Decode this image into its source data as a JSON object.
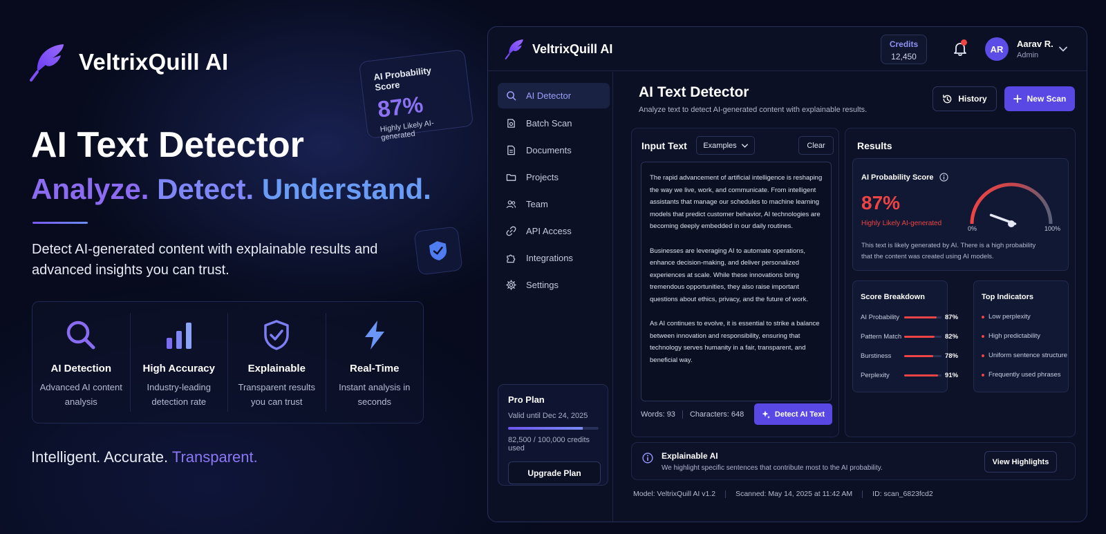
{
  "brand": {
    "name": "VeltrixQuill AI"
  },
  "hero": {
    "title": "AI Text Detector",
    "subtitle_parts": [
      "Analyze.",
      "Detect.",
      "Understand."
    ],
    "description": "Detect AI-generated content with explainable results and advanced insights you can trust.",
    "tagline_main": "Intelligent. Accurate.",
    "tagline_accent": "Transparent."
  },
  "features": [
    {
      "icon": "magnifier-icon",
      "title": "AI Detection",
      "desc": "Advanced AI content analysis"
    },
    {
      "icon": "bar-chart-icon",
      "title": "High Accuracy",
      "desc": "Industry-leading detection rate"
    },
    {
      "icon": "shield-check-icon",
      "title": "Explainable",
      "desc": "Transparent results you can trust"
    },
    {
      "icon": "lightning-icon",
      "title": "Real-Time",
      "desc": "Instant analysis in seconds"
    }
  ],
  "float_card": {
    "label": "AI Probability Score",
    "value": "87%",
    "verdict": "Highly Likely AI-generated"
  },
  "app": {
    "brand": "VeltrixQuill AI",
    "credits": {
      "label": "Credits",
      "value": "12,450"
    },
    "user": {
      "initials": "AR",
      "name": "Aarav R.",
      "role": "Admin"
    },
    "nav": [
      {
        "label": "AI Detector",
        "icon": "search-icon",
        "active": true
      },
      {
        "label": "Batch Scan",
        "icon": "batch-icon"
      },
      {
        "label": "Documents",
        "icon": "document-icon"
      },
      {
        "label": "Projects",
        "icon": "folder-icon"
      },
      {
        "label": "Team",
        "icon": "team-icon"
      },
      {
        "label": "API Access",
        "icon": "link-icon"
      },
      {
        "label": "Integrations",
        "icon": "puzzle-icon"
      },
      {
        "label": "Settings",
        "icon": "gear-icon"
      }
    ],
    "plan": {
      "title": "Pro Plan",
      "valid": "Valid until Dec 24, 2025",
      "usage": "82,500 / 100,000 credits used",
      "usage_fraction": 0.825,
      "button": "Upgrade Plan"
    },
    "page": {
      "title": "AI Text Detector",
      "subtitle": "Analyze text to detect AI-generated content with explainable results.",
      "history": "History",
      "new_scan": "New Scan"
    },
    "input": {
      "title": "Input Text",
      "examples": "Examples",
      "clear": "Clear",
      "paragraphs": [
        "The rapid advancement of artificial intelligence is reshaping the way we live, work, and communicate. From intelligent assistants that manage our schedules to machine learning models that predict customer behavior, AI technologies are becoming deeply embedded in our daily routines.",
        "Businesses are leveraging AI to automate operations, enhance decision-making, and deliver personalized experiences at scale. While these innovations bring tremendous opportunities, they also raise important questions about ethics, privacy, and the future of work.",
        "As AI continues to evolve, it is essential to strike a balance between innovation and responsibility, ensuring that technology serves humanity in a fair, transparent, and beneficial way."
      ],
      "words": "Words: 93",
      "characters": "Characters: 648",
      "detect": "Detect AI Text"
    },
    "results": {
      "title": "Results",
      "score_label": "AI Probability Score",
      "score_value": "87%",
      "score_fraction": 0.87,
      "verdict": "Highly Likely AI-generated",
      "description": "This text is likely generated by AI. There is a high probability that the content was created using AI models.",
      "gauge_min": "0%",
      "gauge_max": "100%",
      "breakdown_title": "Score Breakdown",
      "breakdown": [
        {
          "name": "AI Probability",
          "value": "87%",
          "fraction": 0.87
        },
        {
          "name": "Pattern Match",
          "value": "82%",
          "fraction": 0.82
        },
        {
          "name": "Burstiness",
          "value": "78%",
          "fraction": 0.78
        },
        {
          "name": "Perplexity",
          "value": "91%",
          "fraction": 0.91
        }
      ],
      "indicators_title": "Top Indicators",
      "indicators": [
        "Low perplexity",
        "High predictability",
        "Uniform sentence structure",
        "Frequently used phrases"
      ]
    },
    "explain": {
      "title": "Explainable AI",
      "desc": "We highlight specific sentences that contribute most to the AI probability.",
      "button": "View Highlights"
    },
    "footer": {
      "model": "Model: VeltrixQuill AI v1.2",
      "scanned": "Scanned: May 14, 2025 at 11:42 AM",
      "id": "ID: scan_6823fcd2"
    }
  },
  "colors": {
    "accent": "#5a48e5",
    "danger": "#ef4444",
    "background": "#070b1d"
  }
}
